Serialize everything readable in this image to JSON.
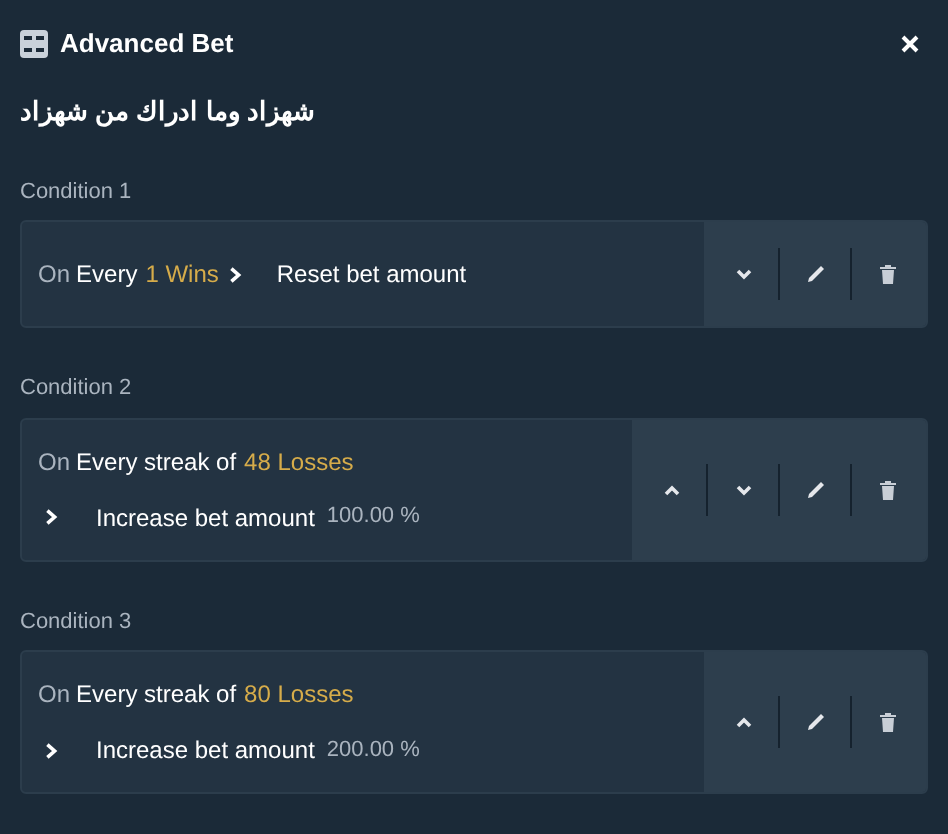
{
  "dialog": {
    "title": "Advanced Bet"
  },
  "subtitle": "شهزاد وما ادراك من شهزاد",
  "conditions": [
    {
      "label": "Condition 1",
      "kind": "inline",
      "prefix": "On",
      "event": "Every",
      "count": "1 Wins",
      "action": "Reset bet amount",
      "buttons": [
        {
          "kind": "down"
        },
        {
          "kind": "edit"
        },
        {
          "kind": "delete"
        }
      ]
    },
    {
      "label": "Condition 2",
      "kind": "stacked",
      "prefix": "On",
      "event": "Every streak of",
      "count": "48 Losses",
      "action": "Increase bet amount",
      "amount": "100.00 %",
      "buttons": [
        {
          "kind": "up"
        },
        {
          "kind": "down"
        },
        {
          "kind": "edit"
        },
        {
          "kind": "delete"
        }
      ]
    },
    {
      "label": "Condition 3",
      "kind": "stacked",
      "prefix": "On",
      "event": "Every streak of",
      "count": "80 Losses",
      "action": "Increase bet amount",
      "amount": "200.00 %",
      "buttons": [
        {
          "kind": "up"
        },
        {
          "kind": "edit"
        },
        {
          "kind": "delete"
        }
      ]
    }
  ]
}
